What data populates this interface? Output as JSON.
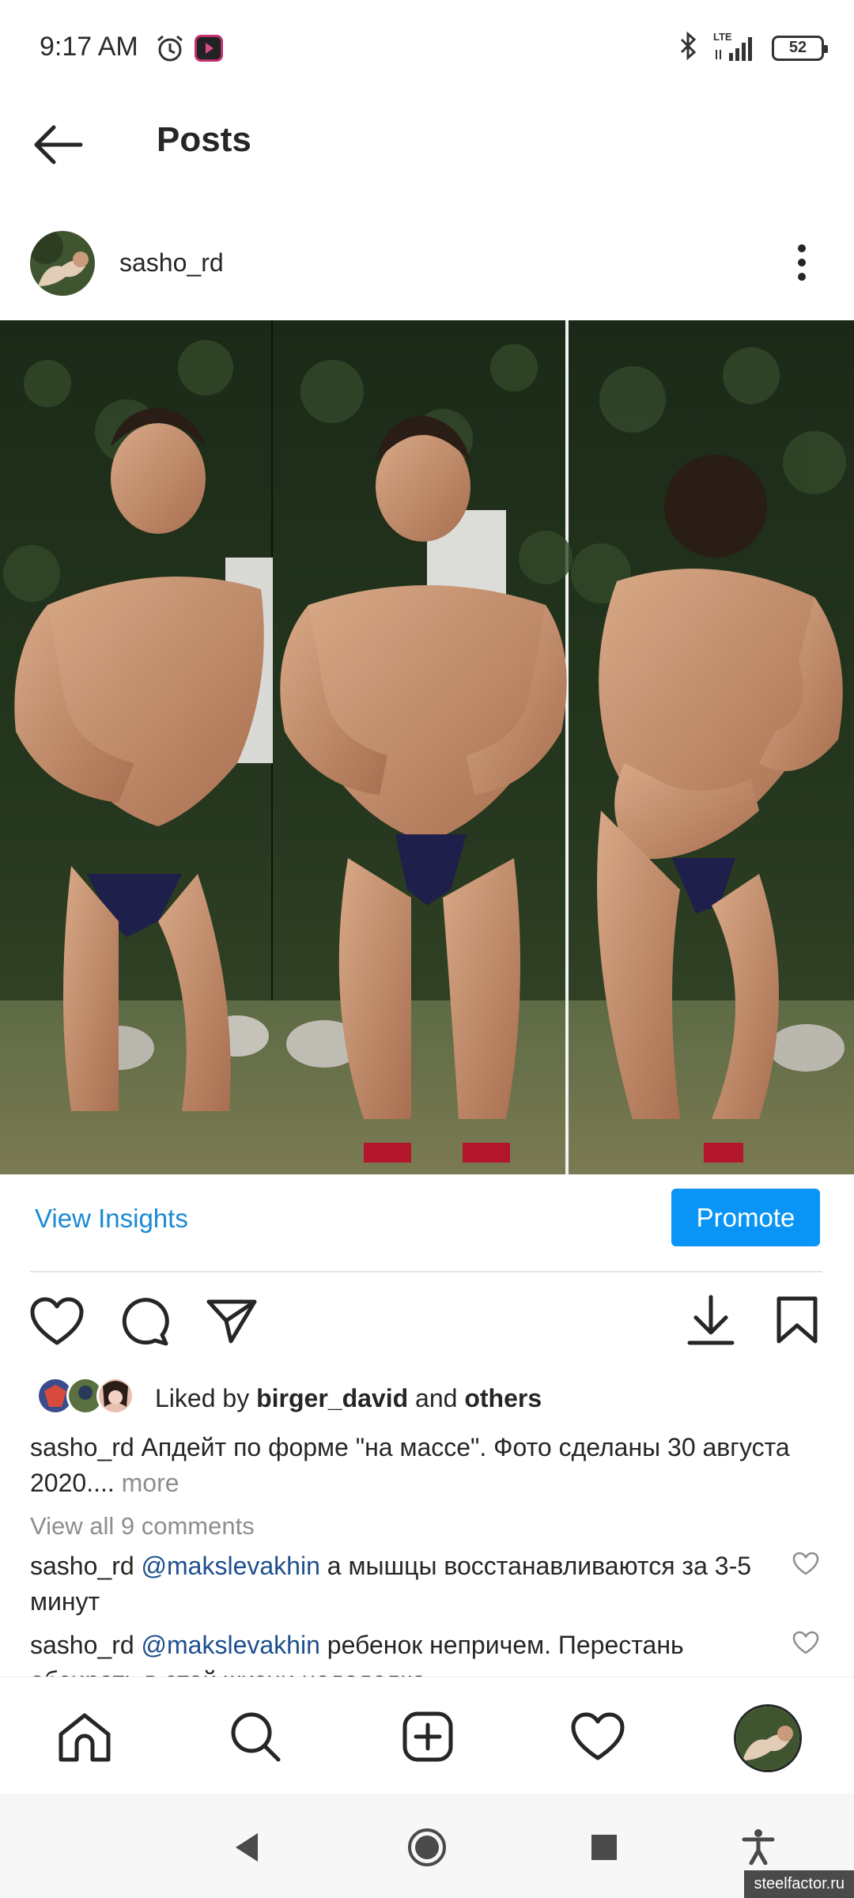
{
  "status_bar": {
    "time": "9:17 AM",
    "network": "LTE",
    "battery": "52"
  },
  "header": {
    "title": "Posts"
  },
  "post": {
    "username": "sasho_rd",
    "view_insights": "View Insights",
    "promote": "Promote",
    "likes": {
      "prefix": "Liked by ",
      "user": "birger_david",
      "middle": " and ",
      "others": "others"
    },
    "caption": {
      "user": "sasho_rd",
      "text": " Апдейт по форме \"на массе\". Фото сделаны 30 августа 2020....",
      "more": " more"
    },
    "view_all_comments": "View all 9 comments",
    "comments": [
      {
        "user": "sasho_rd",
        "mention": "@makslevakhin",
        "text": " а мышцы восстанавливаются за 3-5 минут"
      },
      {
        "user": "sasho_rd",
        "mention": "@makslevakhin",
        "text": " ребенок непричем.  Перестань обсирать в этой жизни недоделка"
      }
    ]
  },
  "watermark": "steelfactor.ru",
  "colors": {
    "accent": "#0a95f6",
    "link": "#1a8ad4",
    "mention": "#1e4f8e",
    "muted": "#8e8e8e"
  }
}
